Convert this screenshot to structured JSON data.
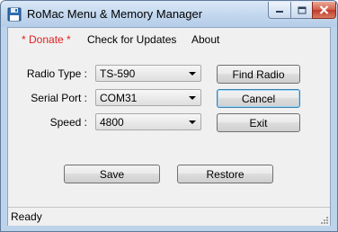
{
  "window": {
    "title": "RoMac Menu & Memory Manager"
  },
  "menu": {
    "donate": "* Donate *",
    "updates": "Check for Updates",
    "about": "About"
  },
  "form": {
    "radio_type_label": "Radio Type :",
    "radio_type_value": "TS-590",
    "serial_port_label": "Serial Port :",
    "serial_port_value": "COM31",
    "speed_label": "Speed :",
    "speed_value": "4800"
  },
  "buttons": {
    "find_radio": "Find Radio",
    "cancel": "Cancel",
    "exit": "Exit",
    "save": "Save",
    "restore": "Restore"
  },
  "status": {
    "text": "Ready"
  },
  "icons": {
    "app": "floppy-disk-icon",
    "minimize": "minimize-icon",
    "maximize": "maximize-icon",
    "close": "close-icon"
  },
  "colors": {
    "donate": "#e02020",
    "close_button": "#c0392b",
    "titlebar": "#c2d7ee"
  }
}
